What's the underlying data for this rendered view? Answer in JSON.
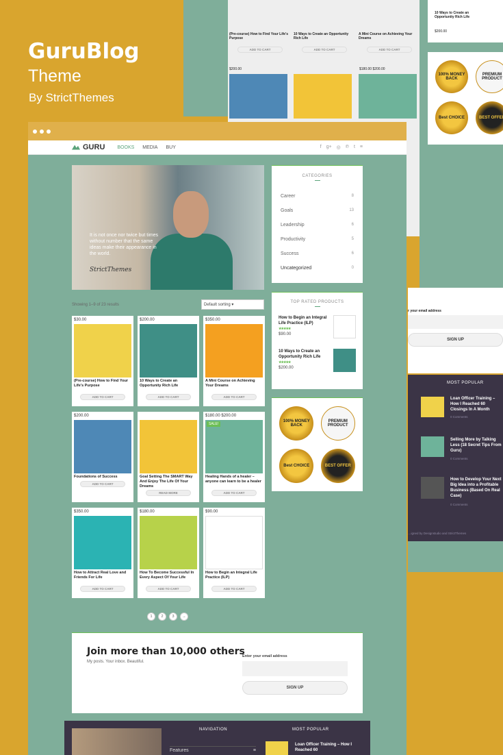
{
  "promo": {
    "brand": "GuruBlog",
    "subtitle": "Theme",
    "byline": "By StrictThemes"
  },
  "nav": {
    "logo": "GURU",
    "menu": [
      "BOOKS",
      "MEDIA",
      "BUY"
    ],
    "social": [
      "f",
      "g+",
      "◎",
      "℗",
      "t"
    ],
    "menu_icon": "≡"
  },
  "hero": {
    "quote": "It is not once nor twice but times without number that the same ideas make their appearance in the world.",
    "signature": "StrictThemes"
  },
  "shop": {
    "results": "Showing 1–9 of 23 results",
    "sort": "Default sorting",
    "products": [
      {
        "price": "$30.00",
        "title": "(Pre-course) How to Find Your Life's Purpose",
        "button": "ADD TO CART",
        "sale": ""
      },
      {
        "price": "$200.00",
        "title": "10 Ways to Create an Opportunity Rich Life",
        "button": "ADD TO CART",
        "sale": ""
      },
      {
        "price": "$350.00",
        "title": "A Mini Course on Achieving Your Dreams",
        "button": "ADD TO CART",
        "sale": ""
      },
      {
        "price": "$200.00",
        "title": "Foundations of Success",
        "button": "ADD TO CART",
        "sale": ""
      },
      {
        "price": "",
        "title": "Goal Setting The SMART Way And Enjoy The Life Of Your Dreams",
        "button": "READ MORE",
        "sale": ""
      },
      {
        "price": "$180.00 $200.00",
        "title": "Healing Hands of a healer – anyone can learn to be a healer",
        "button": "ADD TO CART",
        "sale": "SALE!"
      },
      {
        "price": "$350.00",
        "title": "How to Attract Real Love and Friends For Life",
        "button": "ADD TO CART",
        "sale": ""
      },
      {
        "price": "$180.00",
        "title": "How To Become Successful In Every Aspect Of Your Life",
        "button": "ADD TO CART",
        "sale": ""
      },
      {
        "price": "$90.00",
        "title": "How to Begin an Integral Life Practice (ILP)",
        "button": "ADD TO CART",
        "sale": ""
      }
    ],
    "pages": [
      "1",
      "2",
      "3",
      "→"
    ]
  },
  "sidebar": {
    "categories_title": "CATEGORIES",
    "categories": [
      {
        "name": "Career",
        "count": "8"
      },
      {
        "name": "Goals",
        "count": "13"
      },
      {
        "name": "Leadership",
        "count": "6"
      },
      {
        "name": "Productivity",
        "count": "5"
      },
      {
        "name": "Success",
        "count": "6"
      },
      {
        "name": "Uncategorized",
        "count": "0"
      }
    ],
    "top_title": "TOP RATED PRODUCTS",
    "top": [
      {
        "title": "How to Begin an Integral Life Practice (ILP)",
        "stars": "★★★★★",
        "price": "$90.00"
      },
      {
        "title": "10 Ways to Create an Opportunity Rich Life",
        "stars": "★★★★★",
        "price": "$200.00"
      }
    ],
    "badges": [
      "100% MONEY BACK",
      "PREMIUM PRODUCT",
      "Best CHOICE",
      "BEST OFFER"
    ]
  },
  "newsletter": {
    "title": "Join more than 10,000 others",
    "subtitle": "My posts. Your inbox. Beautiful.",
    "label": "Enter your email address",
    "button": "SIGN UP"
  },
  "footer": {
    "navigation": "NAVIGATION",
    "most_popular": "MOST POPULAR",
    "nav_item": "Features",
    "post": "Loan Officer Training – How I Reached 60"
  },
  "background": {
    "bg_products": [
      {
        "title": "(Pre-course) How to Find Your Life's Purpose",
        "button": "ADD TO CART"
      },
      {
        "title": "10 Ways to Create an Opportunity Rich Life",
        "button": "ADD TO CART"
      },
      {
        "title": "A Mini Course on Achieving Your Dreams",
        "button": "ADD TO CART"
      }
    ],
    "prices": [
      "$200.00",
      "$180.00 $200.00"
    ],
    "card_title": "10 Ways to Create an Opportunity Rich Life",
    "card_price": "$200.00",
    "email_label": "r your email address",
    "signup": "SIGN UP",
    "popular_title": "MOST POPULAR",
    "popular": [
      {
        "title": "Loan Officer Training – How I Reached 60 Closings In A Month",
        "meta": "0 Comments"
      },
      {
        "title": "Selling More by Talking Less (18 Secret Tips From Guru)",
        "meta": "0 Comments"
      },
      {
        "title": "How to Develop Your Next Big Idea into a Profitable Business (Based On Real Case)",
        "meta": "0 Comments"
      }
    ],
    "credit": "…igned by Designstudio and StrictThemes"
  }
}
